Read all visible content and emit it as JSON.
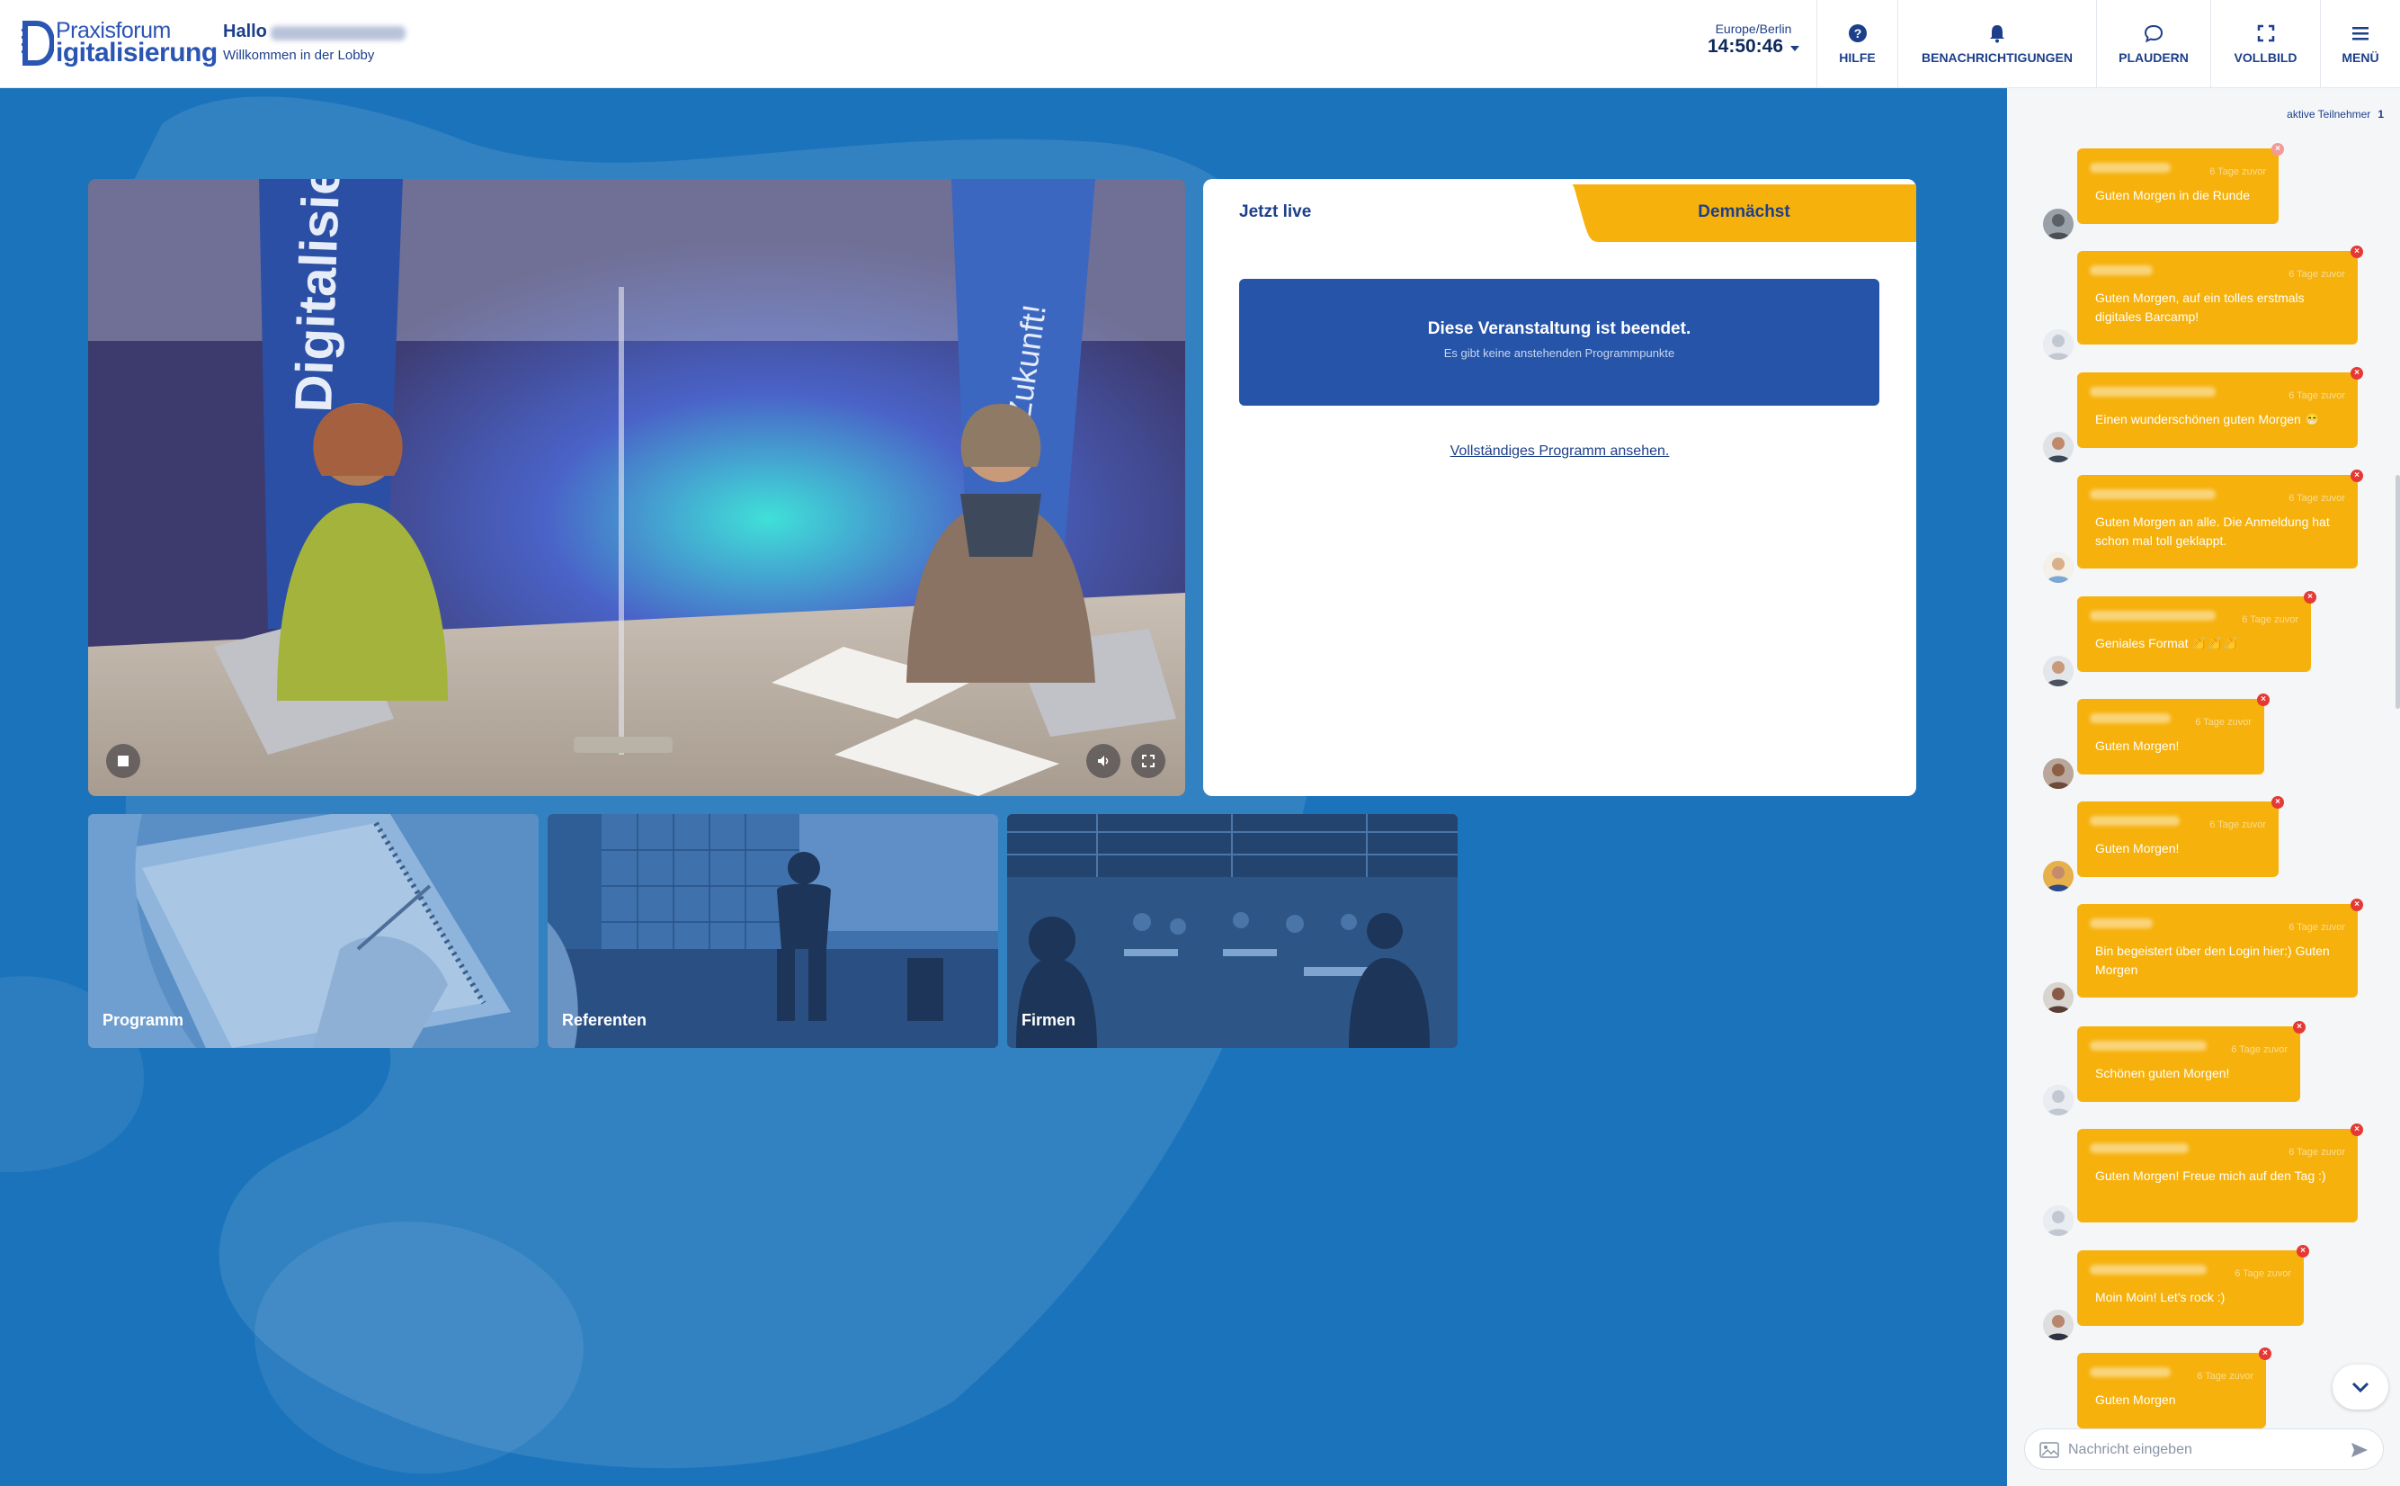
{
  "brand": {
    "line1": "Praxisforum",
    "line2": "igitalisierung"
  },
  "greeting": {
    "hallo": "Hallo",
    "subtitle": "Willkommen in der Lobby"
  },
  "clock": {
    "zone": "Europe/Berlin",
    "time": "14:50:46"
  },
  "nav": [
    {
      "label": "HILFE",
      "icon": "help-icon"
    },
    {
      "label": "BENACHRICHTIGUNGEN",
      "icon": "bell-icon"
    },
    {
      "label": "PLAUDERN",
      "icon": "chat-bubble-icon"
    },
    {
      "label": "VOLLBILD",
      "icon": "fullscreen-icon"
    },
    {
      "label": "MENÜ",
      "icon": "hamburger-icon"
    }
  ],
  "live_panel": {
    "tab_live": "Jetzt live",
    "tab_soon": "Demnächst",
    "ended_title": "Diese Veranstaltung ist beendet.",
    "ended_subtitle": "Es gibt keine anstehenden Programmpunkte",
    "program_link": "Vollständiges Programm ansehen."
  },
  "tiles": [
    {
      "label": "Programm"
    },
    {
      "label": "Referenten"
    },
    {
      "label": "Firmen"
    }
  ],
  "chat": {
    "participants_label": "aktive Teilnehmer",
    "participants_count": "1",
    "input_placeholder": "Nachricht eingeben",
    "messages": [
      {
        "ago": "6 Tage zuvor",
        "text": "Guten Morgen in die Runde"
      },
      {
        "ago": "6 Tage zuvor",
        "text": "Guten Morgen, auf ein tolles erstmals digitales Barcamp!"
      },
      {
        "ago": "6 Tage zuvor",
        "text": "Einen wunderschönen guten Morgen 😁"
      },
      {
        "ago": "6 Tage zuvor",
        "text": "Guten Morgen an alle. Die Anmeldung hat schon mal toll geklappt."
      },
      {
        "ago": "6 Tage zuvor",
        "text": "Geniales Format 👏👏👏"
      },
      {
        "ago": "6 Tage zuvor",
        "text": "Guten Morgen!"
      },
      {
        "ago": "6 Tage zuvor",
        "text": "Guten Morgen!"
      },
      {
        "ago": "6 Tage zuvor",
        "text": "Bin begeistert über den Login hier:) Guten Morgen"
      },
      {
        "ago": "6 Tage zuvor",
        "text": "Schönen guten Morgen!"
      },
      {
        "ago": "6 Tage zuvor",
        "text": "Guten Morgen! Freue mich auf den Tag :)"
      },
      {
        "ago": "6 Tage zuvor",
        "text": "Moin Moin! Let's rock :)"
      },
      {
        "ago": "6 Tage zuvor",
        "text": "Guten Morgen"
      }
    ]
  },
  "colors": {
    "accent": "#f6b10c",
    "primary": "#1d3f8a",
    "background": "#1b74bb",
    "banner": "#2554a8"
  }
}
